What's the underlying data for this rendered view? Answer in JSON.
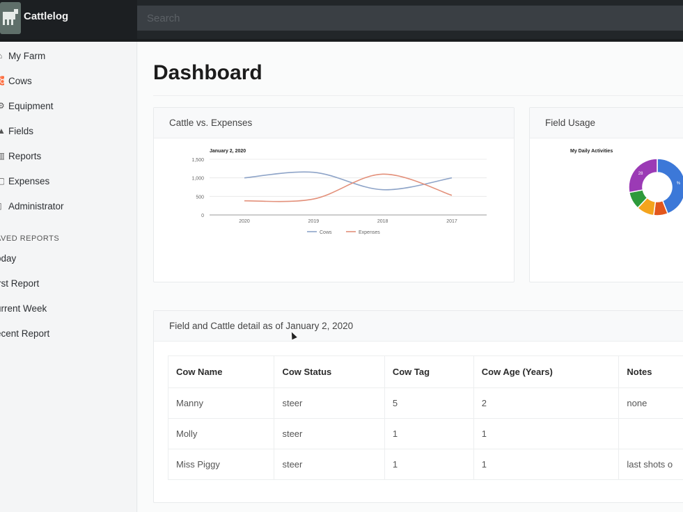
{
  "app": {
    "name": "Cattlelog"
  },
  "search": {
    "placeholder": "Search"
  },
  "sidebar": {
    "items": [
      {
        "label": "My Farm",
        "icon": "home-icon"
      },
      {
        "label": "Cows",
        "icon": "cow-icon"
      },
      {
        "label": "Equipment",
        "icon": "tractor-icon"
      },
      {
        "label": "Fields",
        "icon": "field-icon"
      },
      {
        "label": "Reports",
        "icon": "chart-icon"
      },
      {
        "label": "Expenses",
        "icon": "money-icon"
      },
      {
        "label": "Administrator",
        "icon": "admin-icon"
      }
    ],
    "saved_title": "AVED REPORTS",
    "saved": [
      "oday",
      "irst Report",
      "urrent Week",
      "ecent Report"
    ]
  },
  "page": {
    "title": "Dashboard"
  },
  "cards": {
    "cattle_expenses": {
      "title": "Cattle vs. Expenses"
    },
    "field_usage": {
      "title": "Field Usage"
    },
    "detail": {
      "title": "Field and Cattle detail as of January 2, 2020"
    }
  },
  "chart_data": [
    {
      "type": "line",
      "title": "January 2, 2020",
      "xlabel": "",
      "ylabel": "",
      "categories": [
        "2020",
        "2019",
        "2018",
        "2017"
      ],
      "ylim": [
        0,
        1500
      ],
      "yticks": [
        "0",
        "500",
        "1,000",
        "1,500"
      ],
      "grid": true,
      "legend": "bottom",
      "series": [
        {
          "name": "Cows",
          "color": "#8ea4c8",
          "values": [
            1000,
            1150,
            680,
            1000
          ]
        },
        {
          "name": "Expenses",
          "color": "#e3907a",
          "values": [
            380,
            430,
            1100,
            530
          ]
        }
      ]
    },
    {
      "type": "pie",
      "title": "My Daily Activities",
      "hole": true,
      "slices": [
        {
          "label": "",
          "value": 44,
          "color": "#3c78d8",
          "text": "%"
        },
        {
          "label": "",
          "value": 8,
          "color": "#e2571d",
          "text": ""
        },
        {
          "label": "",
          "value": 10,
          "color": "#f4a41d",
          "text": ""
        },
        {
          "label": "",
          "value": 10,
          "color": "#2e9a3a",
          "text": ""
        },
        {
          "label": "",
          "value": 28,
          "color": "#9b3ab5",
          "text": "28"
        }
      ]
    }
  ],
  "table": {
    "columns": [
      "Cow Name",
      "Cow Status",
      "Cow Tag",
      "Cow Age (Years)",
      "Notes"
    ],
    "rows": [
      [
        "Manny",
        "steer",
        "5",
        "2",
        "none"
      ],
      [
        "Molly",
        "steer",
        "1",
        "1",
        ""
      ],
      [
        "Miss Piggy",
        "steer",
        "1",
        "1",
        "last shots o"
      ]
    ]
  }
}
